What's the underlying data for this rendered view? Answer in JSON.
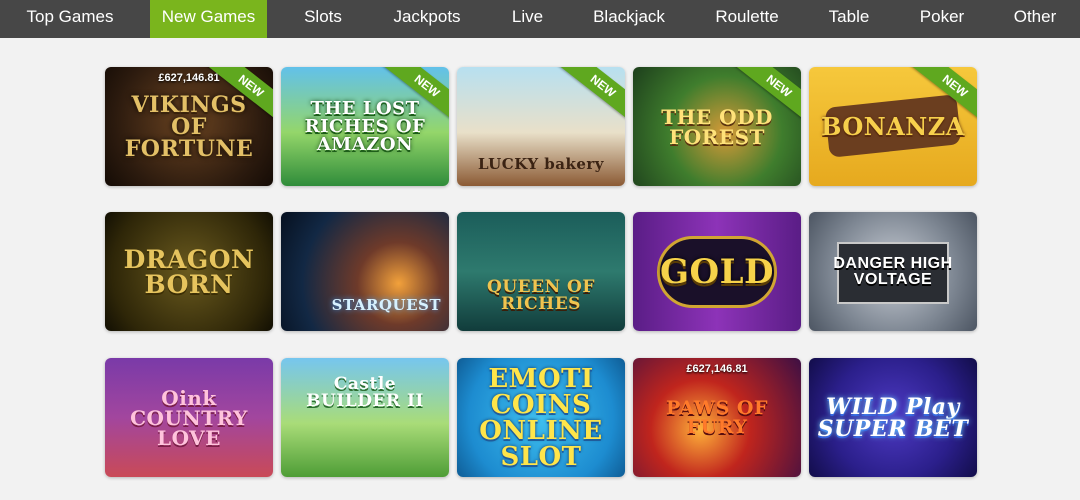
{
  "nav": {
    "tabs": [
      {
        "label": "Top Games"
      },
      {
        "label": "New Games"
      },
      {
        "label": "Slots"
      },
      {
        "label": "Jackpots"
      },
      {
        "label": "Live"
      },
      {
        "label": "Blackjack"
      },
      {
        "label": "Roulette"
      },
      {
        "label": "Table"
      },
      {
        "label": "Poker"
      },
      {
        "label": "Other"
      }
    ],
    "active_tab": "New Games",
    "colors": {
      "bar": "#474747",
      "active": "#7ab51d",
      "text": "#ffffff"
    }
  },
  "games": [
    {
      "title": "VIKINGS OF FORTUNE",
      "jackpot": "£627,146.81",
      "badge": "NEW"
    },
    {
      "title": "THE LOST RICHES OF AMAZON",
      "badge": "NEW"
    },
    {
      "title": "LUCKY bakery",
      "badge": "NEW"
    },
    {
      "title": "THE ODD FOREST",
      "badge": "NEW"
    },
    {
      "title": "BONANZA",
      "badge": "NEW"
    },
    {
      "title": "DRAGON BORN"
    },
    {
      "title": "STARQUEST"
    },
    {
      "title": "QUEEN OF RICHES"
    },
    {
      "title": "GOLD"
    },
    {
      "title": "DANGER HIGH VOLTAGE"
    },
    {
      "title": "Oink COUNTRY LOVE"
    },
    {
      "title": "Castle BUILDER II"
    },
    {
      "title": "EMOTI COINS ONLINE SLOT"
    },
    {
      "title": "PAWS OF FURY",
      "jackpot": "£627,146.81"
    },
    {
      "title": "WILD Play SUPER BET"
    }
  ]
}
